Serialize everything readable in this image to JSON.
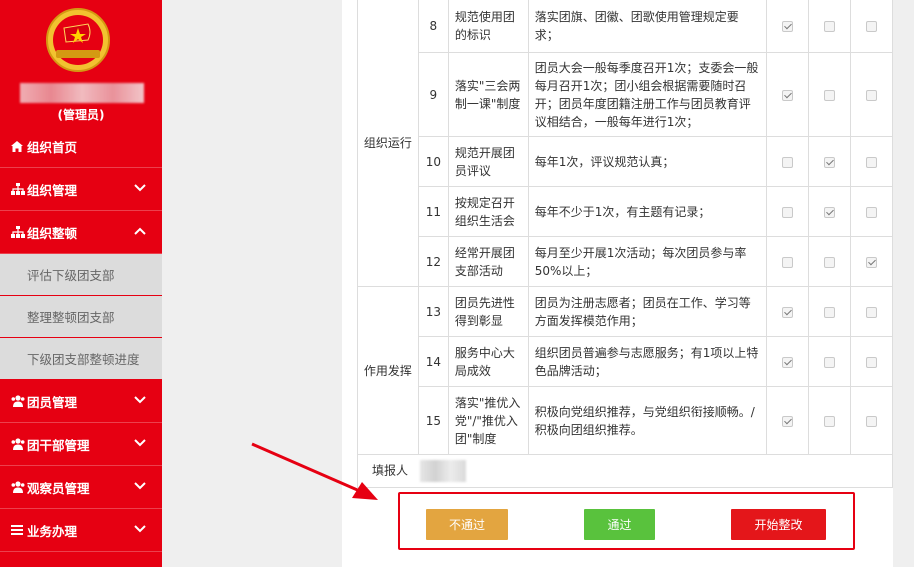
{
  "sidebar": {
    "role": "(管理员)",
    "menu": {
      "home": "组织首页",
      "org_manage": "组织管理",
      "org_rectify": "组织整顿",
      "sub1": "评估下级团支部",
      "sub2": "整理整顿团支部",
      "sub3": "下级团支部整顿进度",
      "member_manage": "团员管理",
      "cadre_manage": "团干部管理",
      "observer_manage": "观察员管理",
      "business": "业务办理"
    }
  },
  "table": {
    "rows": [
      {
        "no": "8",
        "item": "规范使用团的标识",
        "std": "落实团旗、团徽、团歌使用管理规定要求；",
        "checks": [
          true,
          false,
          false
        ]
      },
      {
        "no": "9",
        "item": "落实\"三会两制一课\"制度",
        "std": "团员大会一般每季度召开1次；支委会一般每月召开1次；团小组会根据需要随时召开；团员年度团籍注册工作与团员教育评议相结合，一般每年进行1次；",
        "checks": [
          true,
          false,
          false
        ]
      },
      {
        "no": "10",
        "item": "规范开展团员评议",
        "std": "每年1次，评议规范认真；",
        "checks": [
          false,
          true,
          false
        ]
      },
      {
        "no": "11",
        "item": "按规定召开组织生活会",
        "std": "每年不少于1次，有主题有记录；",
        "checks": [
          false,
          true,
          false
        ]
      },
      {
        "no": "12",
        "item": "经常开展团支部活动",
        "std": "每月至少开展1次活动；每次团员参与率50%以上；",
        "checks": [
          false,
          false,
          true
        ]
      },
      {
        "no": "13",
        "item": "团员先进性得到彰显",
        "std": "团员为注册志愿者；团员在工作、学习等方面发挥模范作用；",
        "checks": [
          true,
          false,
          false
        ]
      },
      {
        "no": "14",
        "item": "服务中心大局成效",
        "std": "组织团员普遍参与志愿服务；有1项以上特色品牌活动；",
        "checks": [
          true,
          false,
          false
        ]
      },
      {
        "no": "15",
        "item": "落实\"推优入党\"/\"推优入团\"制度",
        "std": "积极向党组织推荐，与党组织衔接顺畅。/积极向团组织推荐。",
        "checks": [
          true,
          false,
          false
        ]
      }
    ],
    "cat_org": "组织运行",
    "cat_role": "作用发挥",
    "filler_label": "填报人"
  },
  "buttons": {
    "fail": "不通过",
    "pass": "通过",
    "rectify": "开始整改"
  }
}
